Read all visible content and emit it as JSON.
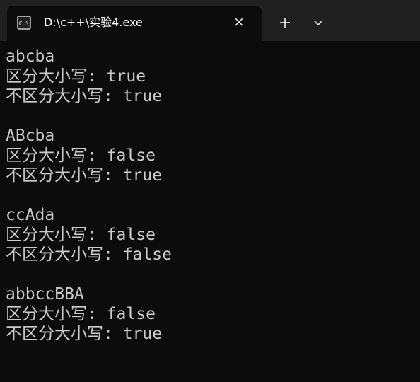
{
  "tab": {
    "title": "D:\\c++\\实验4.exe",
    "icon": "console-icon"
  },
  "controls": {
    "close_icon": "close-icon",
    "new_tab_icon": "plus-icon",
    "dropdown_icon": "chevron-down-icon"
  },
  "console": {
    "lines": [
      "abcba",
      "区分大小写: true",
      "不区分大小写: true",
      "",
      "ABcba",
      "区分大小写: false",
      "不区分大小写: true",
      "",
      "ccAda",
      "区分大小写: false",
      "不区分大小写: false",
      "",
      "abbccBBA",
      "区分大小写: false",
      "不区分大小写: true"
    ]
  }
}
